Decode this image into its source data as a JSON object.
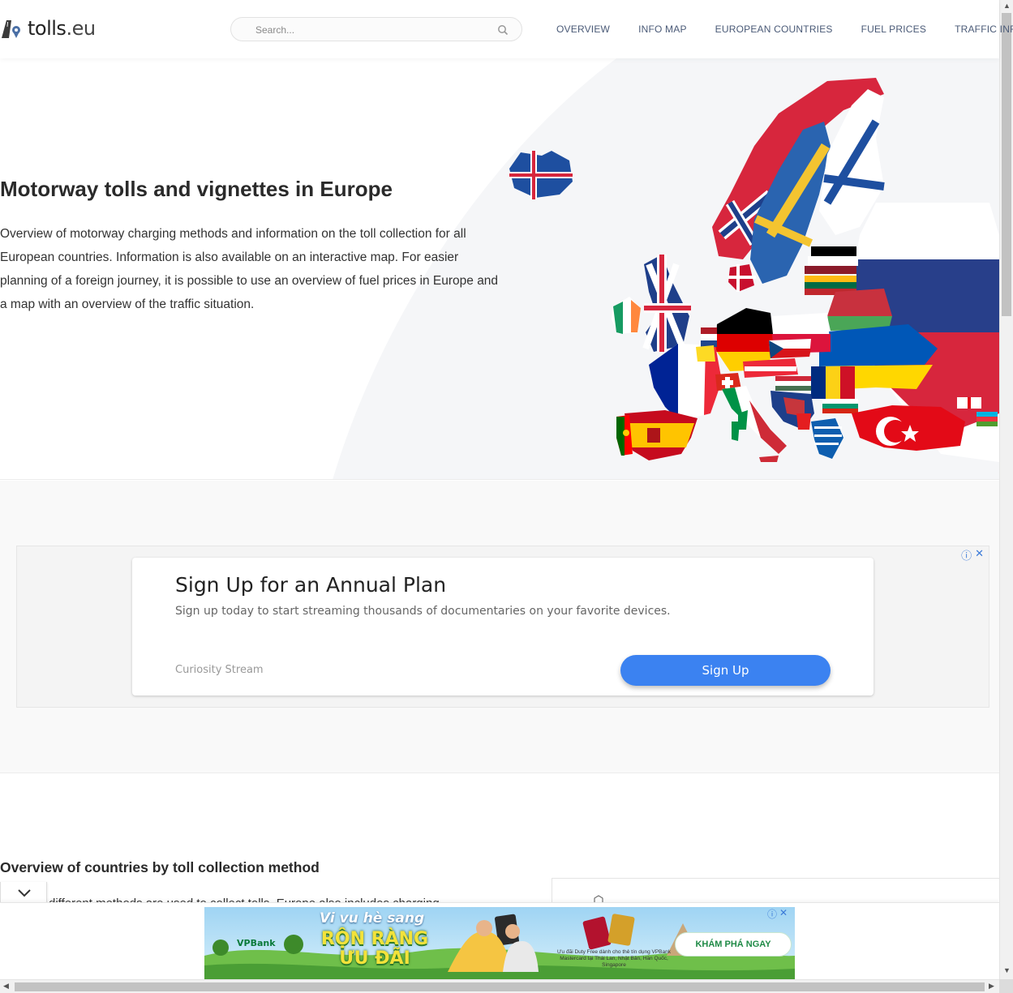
{
  "header": {
    "logo_text": "tolls",
    "logo_tld": ".eu",
    "search_placeholder": "Search...",
    "nav": [
      "OVERVIEW",
      "INFO MAP",
      "EUROPEAN COUNTRIES",
      "FUEL PRICES",
      "TRAFFIC INF"
    ]
  },
  "hero": {
    "title": "Motorway tolls and vignettes in Europe",
    "description": "Overview of motorway charging methods and information on the toll collection for all European countries. Information is also available on an interactive map. For easier planning of a foreign journey, it is possible to use an overview of fuel prices in Europe and a map with an overview of the traffic situation."
  },
  "ad": {
    "title": "Sign Up for an Annual Plan",
    "description": "Sign up today to start streaming thousands of documentaries on your favorite devices.",
    "brand": "Curiosity Stream",
    "button": "Sign Up"
  },
  "overview": {
    "title": "Overview of countries by toll collection method",
    "text_partial": "different methods are used to collect tolls. Europe also includes charging"
  },
  "banner": {
    "headline": "Vi vu hè sang",
    "big_text": "RỘN RÀNG ƯU ĐÃI",
    "brand": "VPBank",
    "small_text": "Ưu đãi Duty Free dành cho thẻ tín dụng VPBank Mastercard tại Thái Lan, Nhật Bản, Hàn Quốc, Singapore",
    "cta": "KHÁM PHÁ NGAY"
  },
  "colors": {
    "nav_text": "#4a5a77",
    "ad_button": "#3b82f1",
    "banner_cta": "#1f8a46"
  }
}
